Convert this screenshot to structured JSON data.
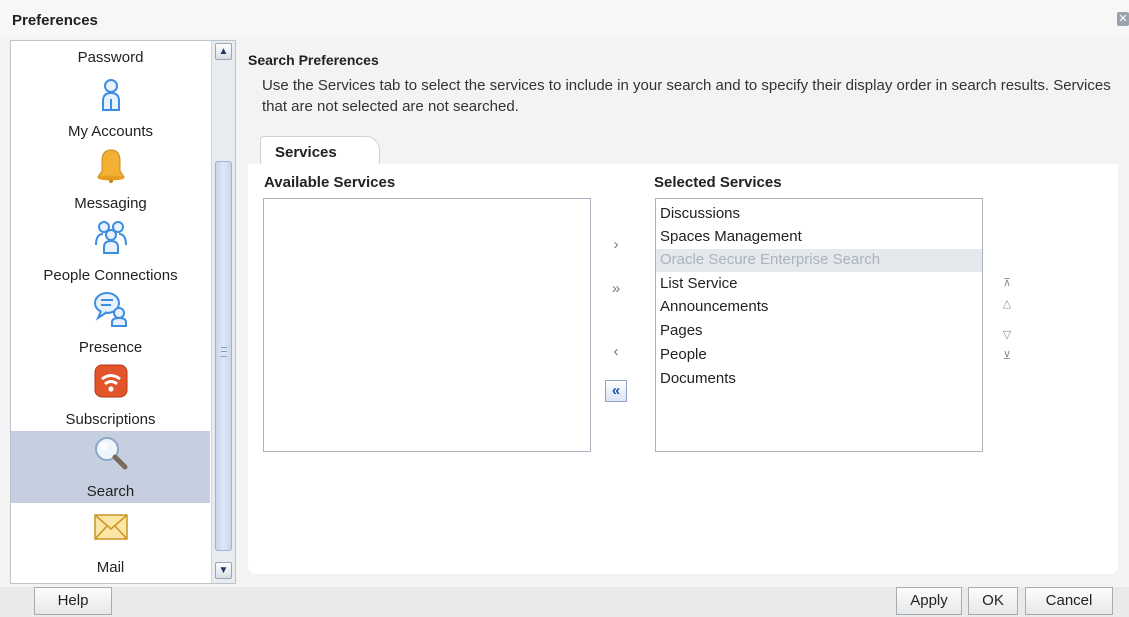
{
  "window": {
    "title": "Preferences",
    "close_glyph": "✕"
  },
  "sidebar": {
    "items": [
      {
        "label": "Password",
        "icon": "password-icon"
      },
      {
        "label": "My Accounts",
        "icon": "person-icon"
      },
      {
        "label": "Messaging",
        "icon": "bell-icon"
      },
      {
        "label": "People Connections",
        "icon": "people-icon"
      },
      {
        "label": "Presence",
        "icon": "chat-person-icon"
      },
      {
        "label": "Subscriptions",
        "icon": "rss-icon"
      },
      {
        "label": "Search",
        "icon": "magnifier-icon",
        "selected": true
      },
      {
        "label": "Mail",
        "icon": "envelope-icon"
      }
    ],
    "scroll_up_glyph": "▲",
    "scroll_down_glyph": "▼"
  },
  "main": {
    "section_title": "Search Preferences",
    "description": "Use the Services tab to select the services to include in your search and to specify their display order in search results. Services that are not selected are not searched.",
    "tab_label": "Services",
    "available_header": "Available Services",
    "selected_header": "Selected Services",
    "available_services": [],
    "selected_services": [
      {
        "label": "Discussions",
        "disabled": false
      },
      {
        "label": "Spaces Management",
        "disabled": false
      },
      {
        "label": "Oracle Secure Enterprise Search",
        "disabled": true
      },
      {
        "label": "List Service",
        "disabled": false
      },
      {
        "label": "Announcements",
        "disabled": false
      },
      {
        "label": "Pages",
        "disabled": false
      },
      {
        "label": "People",
        "disabled": false
      },
      {
        "label": "Documents",
        "disabled": false
      }
    ],
    "shuttle": {
      "move": "›",
      "move_all": "»",
      "remove": "‹",
      "remove_all": "«"
    },
    "order": {
      "top": "⊼",
      "up": "△",
      "down": "▽",
      "bottom": "⊻"
    }
  },
  "footer": {
    "help": "Help",
    "apply": "Apply",
    "ok": "OK",
    "cancel": "Cancel"
  },
  "colors": {
    "selected_row": "#c6cfe0",
    "accent": "#1d4fb3",
    "rss": "#e2542a",
    "bell": "#f2b035",
    "person": "#3d8de0"
  }
}
